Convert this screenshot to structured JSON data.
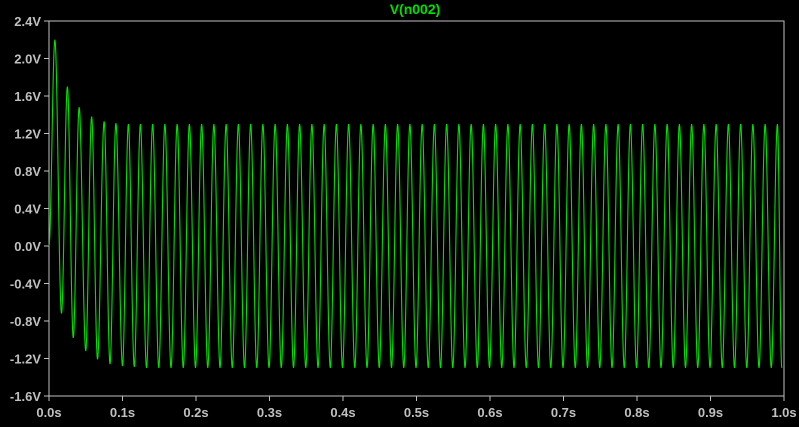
{
  "chart_data": {
    "type": "line",
    "title": "V(n002)",
    "xlabel": "",
    "ylabel": "",
    "xlim": [
      0.0,
      1.0
    ],
    "ylim": [
      -1.6,
      2.4
    ],
    "x_ticks": [
      0.0,
      0.1,
      0.2,
      0.3,
      0.4,
      0.5,
      0.6,
      0.7,
      0.8,
      0.9,
      1.0
    ],
    "x_tick_labels": [
      "0.0s",
      "0.1s",
      "0.2s",
      "0.3s",
      "0.4s",
      "0.5s",
      "0.6s",
      "0.7s",
      "0.8s",
      "0.9s",
      "1.0s"
    ],
    "y_ticks": [
      2.4,
      2.0,
      1.6,
      1.2,
      0.8,
      0.4,
      0.0,
      -0.4,
      -0.8,
      -1.2,
      -1.6
    ],
    "y_tick_labels": [
      "2.4V",
      "2.0V",
      "1.6V",
      "1.2V",
      "0.8V",
      "0.4V",
      "0.0V",
      "-0.4V",
      "-0.8V",
      "-1.2V",
      "-1.6V"
    ],
    "grid": false,
    "series": [
      {
        "name": "V(n002)",
        "color": "#00e000",
        "frequency_hz": 60,
        "peaks": [
          [
            0.008,
            2.2
          ],
          [
            0.025,
            1.7
          ],
          [
            0.041,
            1.48
          ],
          [
            0.058,
            1.38
          ],
          [
            0.075,
            1.33
          ],
          [
            0.091,
            1.31
          ],
          [
            0.108,
            1.3
          ]
        ],
        "troughs": [
          [
            0.017,
            -0.72
          ],
          [
            0.033,
            -0.98
          ],
          [
            0.05,
            -1.12
          ],
          [
            0.066,
            -1.21
          ],
          [
            0.083,
            -1.26
          ],
          [
            0.1,
            -1.28
          ],
          [
            0.116,
            -1.29
          ]
        ],
        "steady_state_max": 1.3,
        "steady_state_min": -1.3,
        "x_end": 0.997,
        "y_end": -1.3
      }
    ]
  }
}
